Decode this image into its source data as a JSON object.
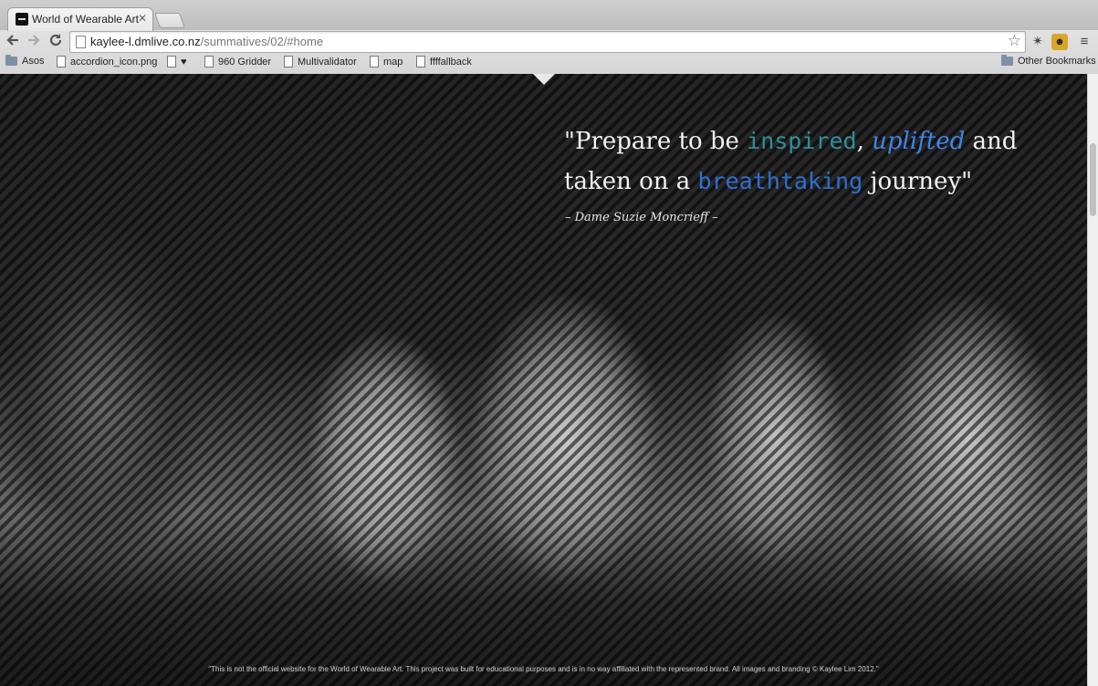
{
  "browser": {
    "tab_title": "World of Wearable Art",
    "tab_close": "✕",
    "url_domain": "kaylee-l.dmlive.co.nz",
    "url_path": "/summatives/02/#home",
    "icons": {
      "back": "back-arrow-icon",
      "forward": "forward-arrow-icon",
      "reload": "reload-icon",
      "star": "bookmark-star-icon",
      "menu": "menu-icon"
    }
  },
  "bookmarks": {
    "items": [
      {
        "label": "Asos",
        "icon": "folder"
      },
      {
        "label": "accordion_icon.png",
        "icon": "doc"
      },
      {
        "label": "♥",
        "icon": "doc"
      },
      {
        "label": "960 Gridder",
        "icon": "doc"
      },
      {
        "label": "Multivalidator",
        "icon": "doc"
      },
      {
        "label": "map",
        "icon": "doc"
      },
      {
        "label": "ffffallback",
        "icon": "doc"
      }
    ],
    "other": "Other Bookmarks"
  },
  "hero": {
    "quote_open": "\"Prepare to be ",
    "word_inspired": "inspired",
    "comma": ", ",
    "word_uplifted": "uplifted",
    "and": " and",
    "line2_start": "taken on a ",
    "word_breathtaking": "breathtaking",
    "line2_end": " journey\"",
    "attribution": "– Dame Suzie Moncrieff –",
    "disclaimer": "\"This is not the official website for the World of Wearable Art. This project was built for educational purposes and is in no way affiliated with the represented brand. All images and branding © Kaylee Lim 2012.\""
  },
  "colors": {
    "teal": "#2f8f97",
    "blue": "#2e6fd0"
  }
}
